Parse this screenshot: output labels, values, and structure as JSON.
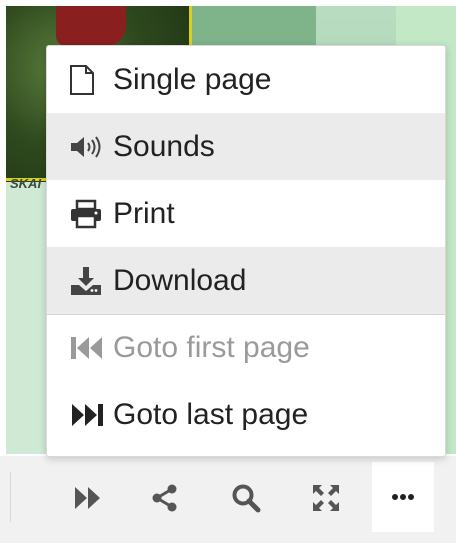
{
  "menu": {
    "items": [
      {
        "label": "Single page",
        "icon": "page-icon",
        "shaded": false,
        "disabled": false
      },
      {
        "label": "Sounds",
        "icon": "speaker-icon",
        "shaded": true,
        "disabled": false
      },
      {
        "label": "Print",
        "icon": "printer-icon",
        "shaded": false,
        "disabled": false
      },
      {
        "label": "Download",
        "icon": "download-icon",
        "shaded": true,
        "disabled": false
      },
      {
        "label": "Goto first page",
        "icon": "first-page-icon",
        "shaded": false,
        "disabled": true
      },
      {
        "label": "Goto last page",
        "icon": "last-page-icon",
        "shaded": false,
        "disabled": false
      }
    ]
  },
  "toolbar": {
    "buttons": [
      "next-page-icon",
      "share-icon",
      "search-icon",
      "fullscreen-icon",
      "more-icon"
    ]
  },
  "background": {
    "caption": "SKAI"
  },
  "colors": {
    "menu_bg": "#ffffff",
    "menu_hover": "#ebebeb",
    "text": "#222222",
    "disabled_text": "#9a9a9a",
    "toolbar_bg": "#f1f1f1",
    "icon": "#555555"
  }
}
